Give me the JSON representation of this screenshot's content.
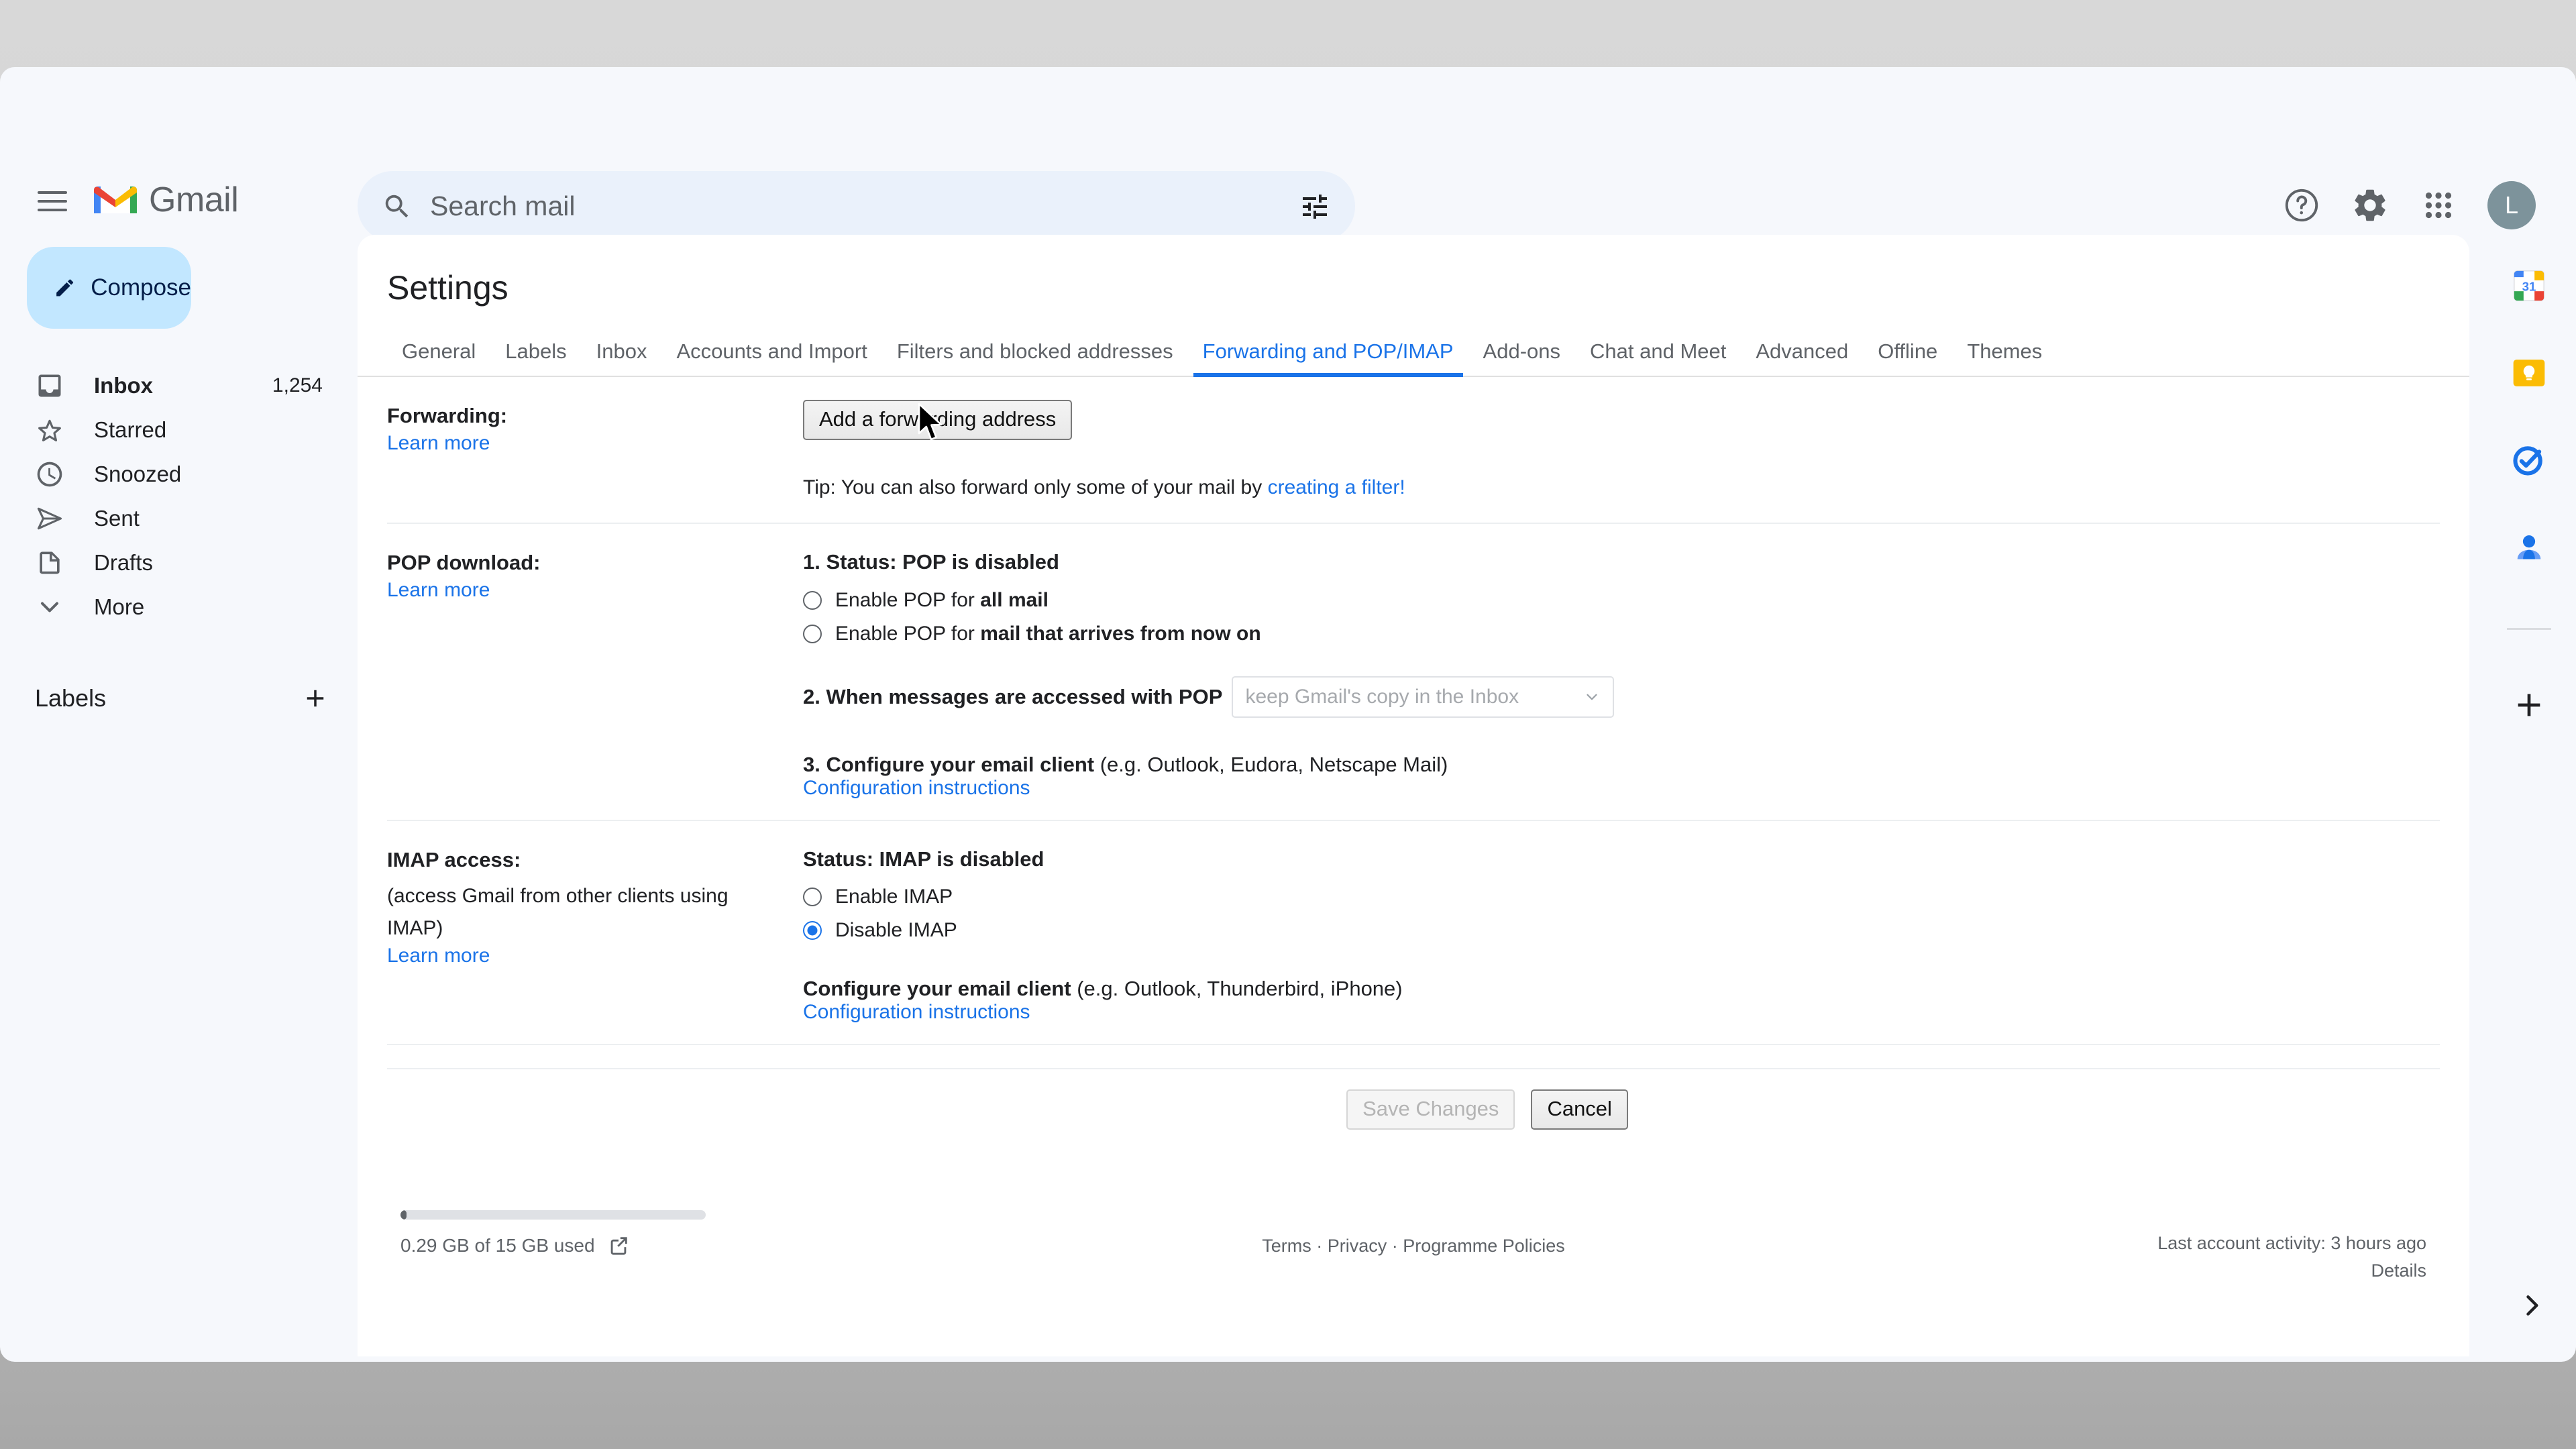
{
  "header": {
    "menu_icon": "hamburger-icon",
    "brand": "Gmail",
    "search": {
      "icon": "search-icon",
      "placeholder": "Search mail",
      "value": "",
      "filter_icon": "tune-filter-icon"
    },
    "actions": [
      {
        "name": "help-icon",
        "label": "Support"
      },
      {
        "name": "gear-icon",
        "label": "Settings"
      },
      {
        "name": "apps-grid-icon",
        "label": "Google apps"
      }
    ],
    "avatar_letter": "L"
  },
  "sidebar": {
    "compose": {
      "label": "Compose",
      "icon": "pencil-icon"
    },
    "items": [
      {
        "icon": "inbox-icon",
        "label": "Inbox",
        "count": "1,254",
        "active": true
      },
      {
        "icon": "star-icon",
        "label": "Starred",
        "count": "",
        "active": false
      },
      {
        "icon": "clock-icon",
        "label": "Snoozed",
        "count": "",
        "active": false
      },
      {
        "icon": "send-icon",
        "label": "Sent",
        "count": "",
        "active": false
      },
      {
        "icon": "draft-icon",
        "label": "Drafts",
        "count": "",
        "active": false
      },
      {
        "icon": "chevron-down-icon",
        "label": "More",
        "count": "",
        "active": false
      }
    ],
    "labels_title": "Labels",
    "add_label_icon": "plus-icon"
  },
  "right_rail": {
    "icons": [
      "google-calendar-icon",
      "google-keep-icon",
      "google-tasks-icon",
      "google-contacts-icon"
    ],
    "add_icon": "plus-icon",
    "expand_icon": "chevron-right-icon"
  },
  "main": {
    "title": "Settings",
    "tabs": [
      {
        "label": "General",
        "active": false
      },
      {
        "label": "Labels",
        "active": false
      },
      {
        "label": "Inbox",
        "active": false
      },
      {
        "label": "Accounts and Import",
        "active": false
      },
      {
        "label": "Filters and blocked addresses",
        "active": false
      },
      {
        "label": "Forwarding and POP/IMAP",
        "active": true
      },
      {
        "label": "Add-ons",
        "active": false
      },
      {
        "label": "Chat and Meet",
        "active": false
      },
      {
        "label": "Advanced",
        "active": false
      },
      {
        "label": "Offline",
        "active": false
      },
      {
        "label": "Themes",
        "active": false
      }
    ],
    "forwarding": {
      "title": "Forwarding:",
      "learn_more": "Learn more",
      "add_button": "Add a forwarding address",
      "tip_prefix": "Tip: You can also forward only some of your mail by ",
      "tip_link": "creating a filter!"
    },
    "pop": {
      "title": "POP download:",
      "learn_more": "Learn more",
      "status": "1. Status: POP is disabled",
      "options": [
        {
          "prefix": "Enable POP for ",
          "bold": "all mail",
          "checked": false
        },
        {
          "prefix": "Enable POP for ",
          "bold": "mail that arrives from now on",
          "checked": false
        }
      ],
      "step2_label": "2. When messages are accessed with POP",
      "step2_select_value": "keep Gmail's copy in the Inbox",
      "step3_bold": "3. Configure your email client",
      "step3_rest": " (e.g. Outlook, Eudora, Netscape Mail)",
      "step3_link": "Configuration instructions"
    },
    "imap": {
      "title": "IMAP access:",
      "subtitle": "(access Gmail from other clients using IMAP)",
      "learn_more": "Learn more",
      "status": "Status: IMAP is disabled",
      "options": [
        {
          "label": "Enable IMAP",
          "checked": false
        },
        {
          "label": "Disable IMAP",
          "checked": true
        }
      ],
      "configure_bold": "Configure your email client",
      "configure_rest": " (e.g. Outlook, Thunderbird, iPhone)",
      "configure_link": "Configuration instructions"
    },
    "actions": {
      "save_label": "Save Changes",
      "save_disabled": true,
      "cancel_label": "Cancel"
    }
  },
  "footer": {
    "storage_text": "0.29 GB of 15 GB used",
    "storage_percent": 2,
    "external_icon": "external-link-icon",
    "links": [
      "Terms",
      "Privacy",
      "Programme Policies"
    ],
    "separator": " · ",
    "last_activity": "Last account activity: 3 hours ago",
    "details": "Details"
  },
  "colors": {
    "accent": "#1a73e8",
    "compose_bg": "#c2e7ff",
    "app_bg": "#f6f8fc",
    "card_bg": "#ffffff"
  }
}
